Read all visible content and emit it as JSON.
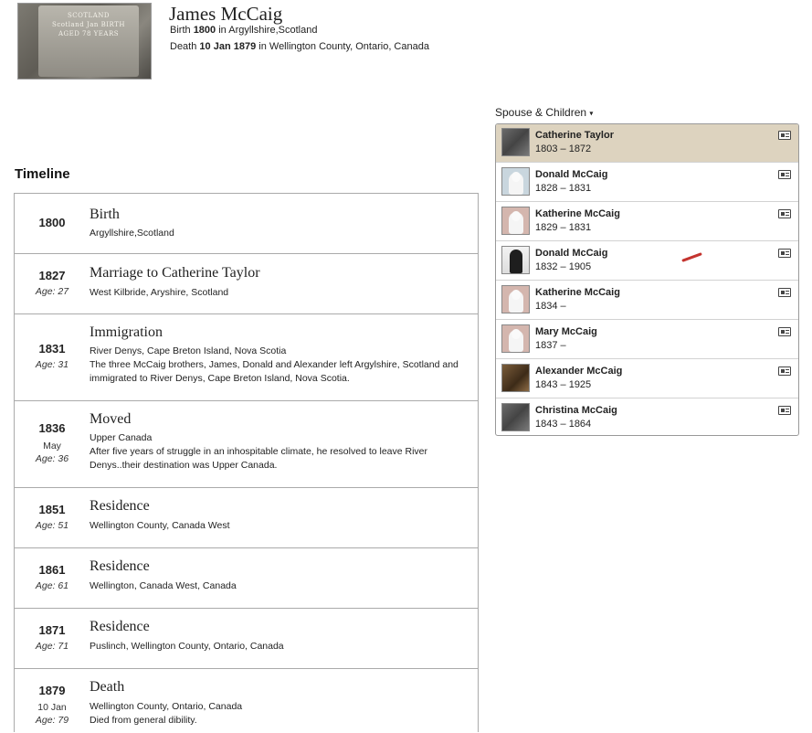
{
  "person": {
    "name": "James McCaig",
    "birth_label": "Birth",
    "birth_date": "1800",
    "birth_place": "in Argyllshire,Scotland",
    "death_label": "Death",
    "death_date": "10 Jan 1879",
    "death_place": "in Wellington County, Ontario, Canada",
    "photo_text": [
      "SCOTLAND",
      "Scotland Jan BIRTH",
      "AGED 78 YEARS"
    ]
  },
  "timeline": {
    "title": "Timeline",
    "events": [
      {
        "year": "1800",
        "sub": "",
        "age_label": "",
        "age": "",
        "title": "Birth",
        "place": "Argyllshire,Scotland",
        "desc": ""
      },
      {
        "year": "1827",
        "sub": "",
        "age_label": "Age:",
        "age": "27",
        "title": "Marriage to Catherine Taylor",
        "place": "West Kilbride, Aryshire, Scotland",
        "desc": ""
      },
      {
        "year": "1831",
        "sub": "",
        "age_label": "Age:",
        "age": "31",
        "title": "Immigration",
        "place": "River Denys, Cape Breton Island, Nova Scotia",
        "desc": "The three McCaig brothers, James, Donald and Alexander left Argylshire, Scotland and immigrated to River Denys, Cape Breton Island, Nova Scotia."
      },
      {
        "year": "1836",
        "sub": "May",
        "age_label": "Age:",
        "age": "36",
        "title": "Moved",
        "place": "Upper Canada",
        "desc": "After five years of struggle in an inhospitable climate, he resolved to leave River Denys..their destination was Upper Canada."
      },
      {
        "year": "1851",
        "sub": "",
        "age_label": "Age:",
        "age": "51",
        "title": "Residence",
        "place": "Wellington County, Canada West",
        "desc": ""
      },
      {
        "year": "1861",
        "sub": "",
        "age_label": "Age:",
        "age": "61",
        "title": "Residence",
        "place": "Wellington, Canada West, Canada",
        "desc": ""
      },
      {
        "year": "1871",
        "sub": "",
        "age_label": "Age:",
        "age": "71",
        "title": "Residence",
        "place": "Puslinch, Wellington County, Ontario, Canada",
        "desc": ""
      },
      {
        "year": "1879",
        "sub": "10 Jan",
        "age_label": "Age:",
        "age": "79",
        "title": "Death",
        "place": "Wellington County, Ontario, Canada",
        "desc": "Died from general dibility."
      }
    ]
  },
  "family": {
    "header": "Spouse & Children",
    "caret": "▾",
    "members": [
      {
        "name": "Catherine Taylor",
        "dates": "1803 – 1872",
        "thumb": "photo-d",
        "icon": "profile-card-icon"
      },
      {
        "name": "Donald McCaig",
        "dates": "1828 – 1831",
        "thumb": "sil-blue",
        "icon": "profile-card-icon"
      },
      {
        "name": "Katherine McCaig",
        "dates": "1829 – 1831",
        "thumb": "sil-pink",
        "icon": "profile-card-icon"
      },
      {
        "name": "Donald McCaig",
        "dates": "1832 – 1905",
        "thumb": "photo-b",
        "icon": "profile-card-icon"
      },
      {
        "name": "Katherine McCaig",
        "dates": "1834 –",
        "thumb": "sil-pink",
        "icon": "profile-card-icon"
      },
      {
        "name": "Mary McCaig",
        "dates": "1837 –",
        "thumb": "sil-pink",
        "icon": "profile-card-icon"
      },
      {
        "name": "Alexander McCaig",
        "dates": "1843 – 1925",
        "thumb": "photo-c",
        "icon": "profile-card-icon"
      },
      {
        "name": "Christina McCaig",
        "dates": "1843 – 1864",
        "thumb": "photo-d",
        "icon": "profile-card-icon"
      }
    ]
  },
  "colors": {
    "selected_row": "#ddd3bf",
    "annotation_stroke": "#c4342f"
  }
}
